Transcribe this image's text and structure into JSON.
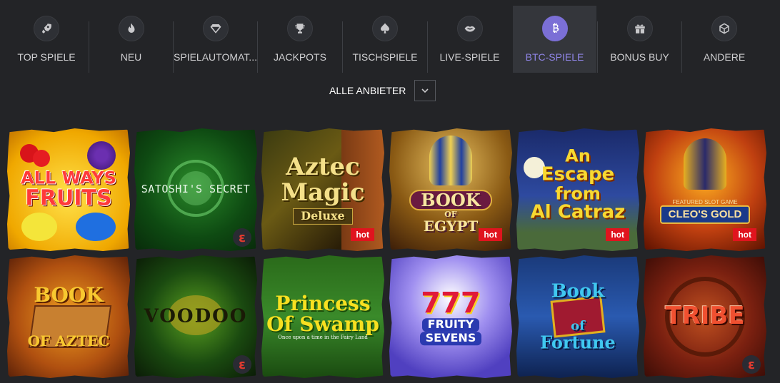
{
  "categories": [
    {
      "label": "TOP SPIELE",
      "icon": "rocket-icon"
    },
    {
      "label": "NEU",
      "icon": "flame-icon"
    },
    {
      "label": "SPIELAUTOMAT...",
      "icon": "diamond-icon"
    },
    {
      "label": "JACKPOTS",
      "icon": "trophy-icon"
    },
    {
      "label": "TISCHSPIELE",
      "icon": "spade-icon"
    },
    {
      "label": "LIVE-SPIELE",
      "icon": "lips-icon"
    },
    {
      "label": "BTC-SPIELE",
      "icon": "bitcoin-icon",
      "active": true
    },
    {
      "label": "BONUS BUY",
      "icon": "gift-icon"
    },
    {
      "label": "ANDERE",
      "icon": "cube-icon"
    }
  ],
  "provider_filter": {
    "label": "ALLE ANBIETER",
    "icon": "chevron-down-icon"
  },
  "games": [
    {
      "title": "ALL WAYS FRUITS",
      "line1": "ALL WAYS",
      "line2": "FRUITS",
      "hot": false
    },
    {
      "title": "SATOSHI'S SECRET",
      "line1": "SATOSHI'S SECRET",
      "hot": false,
      "provider_badge": true
    },
    {
      "title": "Aztec Magic Deluxe",
      "line1": "Aztec",
      "line2": "Magic",
      "line3": "Deluxe",
      "hot": true
    },
    {
      "title": "Book of Egypt",
      "line1": "BOOK",
      "line2": "OF",
      "line3": "EGYPT",
      "hot": true
    },
    {
      "title": "An Escape from Alcatraz",
      "line1": "An",
      "line2": "Escape",
      "line3": "from",
      "line4": "Al Catraz",
      "hot": true
    },
    {
      "title": "Cleo's Gold",
      "line1": "FEATURED SLOT GAME",
      "line2": "CLEO'S GOLD",
      "hot": true
    },
    {
      "title": "Book of Aztec",
      "line1": "BOOK",
      "line2": "OF AZTEC",
      "hot": false
    },
    {
      "title": "Voodoo",
      "line1": "VOODOO",
      "hot": false,
      "provider_badge": true
    },
    {
      "title": "Princess of Swamp",
      "line1": "Princess",
      "line2": "Of Swamp",
      "line3": "Once upon a time in the Fairy Land",
      "hot": false
    },
    {
      "title": "Fruity Sevens",
      "line1": "777",
      "line2": "FRUITY",
      "line3": "SEVENS",
      "hot": false
    },
    {
      "title": "Book of Fortune",
      "line1": "Book",
      "line2": "of",
      "line3": "Fortune",
      "hot": false
    },
    {
      "title": "Tribe",
      "line1": "TRIBE",
      "hot": false,
      "provider_badge": true
    }
  ],
  "hot_label": "hot",
  "colors": {
    "accent": "#7b6fd6",
    "hot": "#e0141e",
    "background": "#232427"
  }
}
